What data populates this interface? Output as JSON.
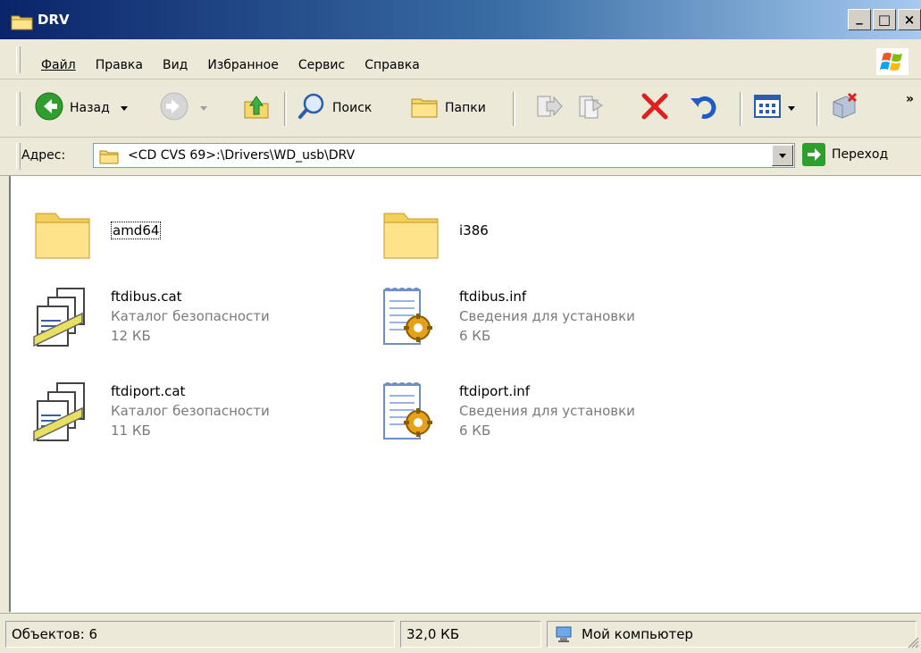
{
  "window": {
    "title": "DRV",
    "minimize_label": "_",
    "maximize_label": "□",
    "close_label": "×"
  },
  "menu": {
    "items": [
      {
        "label": "Файл"
      },
      {
        "label": "Правка"
      },
      {
        "label": "Вид"
      },
      {
        "label": "Избранное"
      },
      {
        "label": "Сервис"
      },
      {
        "label": "Справка"
      }
    ]
  },
  "toolbar": {
    "back_label": "Назад",
    "search_label": "Поиск",
    "folders_label": "Папки",
    "more_label": "»"
  },
  "address": {
    "label": "Адрес:",
    "value": "<CD CVS 69>:\\Drivers\\WD_usb\\DRV",
    "go_label": "Переход"
  },
  "files": [
    {
      "name": "amd64",
      "type": "",
      "size": "",
      "icon": "folder-icon"
    },
    {
      "name": "i386",
      "type": "",
      "size": "",
      "icon": "folder-icon"
    },
    {
      "name": "ftdibus.cat",
      "type": "Каталог безопасности",
      "size": "12 КБ",
      "icon": "security-catalog-icon"
    },
    {
      "name": "ftdibus.inf",
      "type": "Сведения для установки",
      "size": "6 КБ",
      "icon": "setup-information-icon"
    },
    {
      "name": "ftdiport.cat",
      "type": "Каталог безопасности",
      "size": "11 КБ",
      "icon": "security-catalog-icon"
    },
    {
      "name": "ftdiport.inf",
      "type": "Сведения для установки",
      "size": "6 КБ",
      "icon": "setup-information-icon"
    }
  ],
  "status": {
    "objects": "Объектов: 6",
    "size": "32,0 КБ",
    "location": "Мой компьютер"
  },
  "colors": {
    "titlebar_start": "#0a246a",
    "titlebar_end": "#a6caf0",
    "chrome": "#ece9d8",
    "go_green": "#2ca02c",
    "delete_red": "#e02020"
  }
}
